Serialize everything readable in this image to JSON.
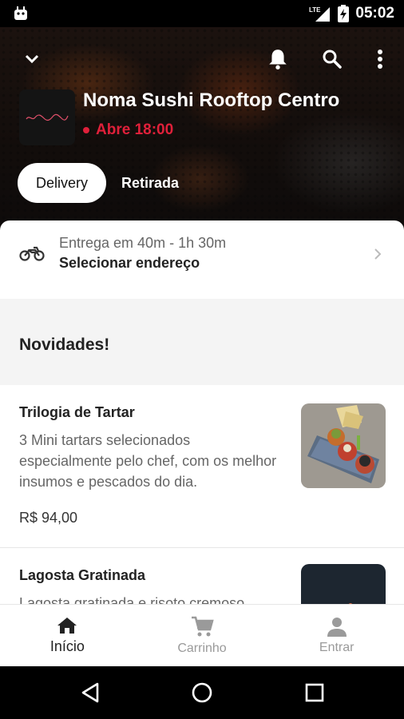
{
  "status_bar": {
    "time": "05:02",
    "network": "LTE"
  },
  "store": {
    "name": "Noma Sushi Rooftop Centro",
    "status": "Abre 18:00"
  },
  "mode_tabs": {
    "delivery": "Delivery",
    "pickup": "Retirada"
  },
  "delivery": {
    "eta": "Entrega em 40m - 1h 30m",
    "address_cta": "Selecionar endereço"
  },
  "section": {
    "title": "Novidades!"
  },
  "items": [
    {
      "name": "Trilogia de Tartar",
      "description": "3 Mini tartars selecionados especialmente pelo chef, com os melhor insumos e pescados do dia.",
      "price": "R$ 94,00"
    },
    {
      "name": "Lagosta Gratinada",
      "description": "Lagosta gratinada e risoto cremoso"
    }
  ],
  "bottom_nav": [
    {
      "label": "Início",
      "icon": "home-icon",
      "active": true
    },
    {
      "label": "Carrinho",
      "icon": "cart-icon",
      "active": false
    },
    {
      "label": "Entrar",
      "icon": "person-icon",
      "active": false
    }
  ],
  "colors": {
    "accent": "#e0203a",
    "text_dark": "#222222",
    "text_muted": "#666666"
  }
}
